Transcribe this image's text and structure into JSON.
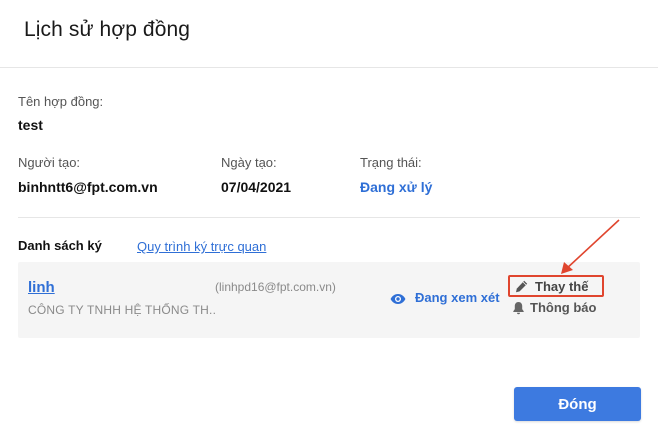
{
  "modal": {
    "title": "Lịch sử hợp đồng"
  },
  "contract": {
    "name_label": "Tên hợp đồng:",
    "name_value": "test",
    "creator_label": "Người tạo:",
    "creator_value": "binhntt6@fpt.com.vn",
    "date_label": "Ngày tạo:",
    "date_value": "07/04/2021",
    "status_label": "Trạng thái:",
    "status_value": "Đang xử lý"
  },
  "signers": {
    "section_title": "Danh sách ký",
    "visual_link": "Quy trình ký trực quan",
    "items": [
      {
        "name": "linh",
        "company": "CÔNG TY TNHH HỆ THỐNG TH..",
        "email": "(linhpd16@fpt.com.vn)",
        "status": "Đang xem xét",
        "replace_label": "Thay thế",
        "notify_label": "Thông báo"
      }
    ]
  },
  "footer": {
    "close_label": "Đóng"
  },
  "colors": {
    "accent": "#2f6fd6",
    "button": "#3d7ae0",
    "highlight": "#e0452e"
  },
  "icons": {
    "status": "eye-icon",
    "replace": "pencil-icon",
    "notify": "bell-icon"
  }
}
